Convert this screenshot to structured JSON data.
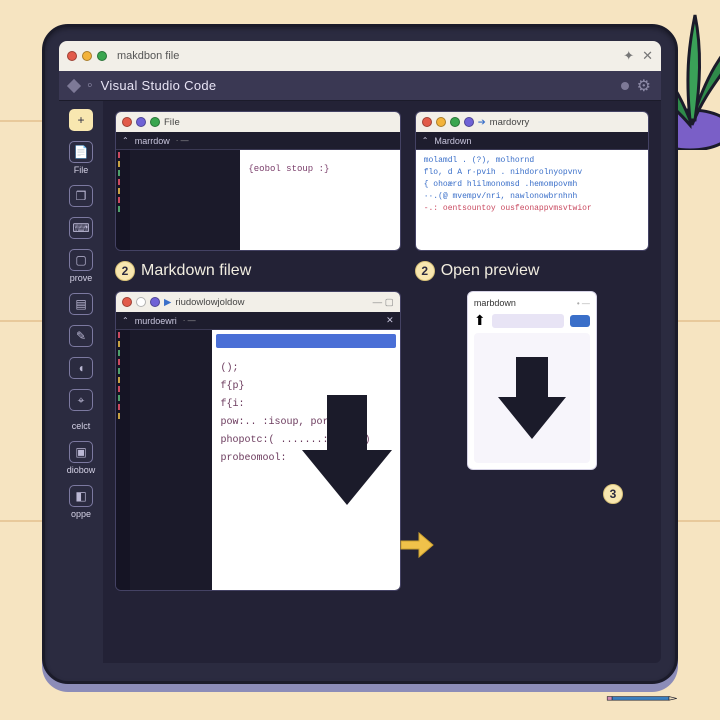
{
  "titlebar": {
    "tab_label": "makdbon file",
    "sparkle": "✦",
    "close": "✕"
  },
  "appbar": {
    "title": "Visual Studio Code"
  },
  "activity": {
    "items": [
      {
        "name": "add",
        "icon": "+",
        "label": ""
      },
      {
        "name": "file",
        "icon": "",
        "label": "File"
      },
      {
        "name": "copy",
        "icon": "❐",
        "label": ""
      },
      {
        "name": "keyboard",
        "icon": "⌨",
        "label": ""
      },
      {
        "name": "preview",
        "icon": "▢",
        "label": "prove"
      },
      {
        "name": "layers",
        "icon": "▤",
        "label": ""
      },
      {
        "name": "brush",
        "icon": "✎",
        "label": ""
      },
      {
        "name": "shape",
        "icon": "◖",
        "label": ""
      },
      {
        "name": "bug",
        "icon": "⌖",
        "label": ""
      },
      {
        "name": "select",
        "icon": "",
        "label": "celct"
      },
      {
        "name": "box",
        "icon": "▣",
        "label": "diobow"
      },
      {
        "name": "open",
        "icon": "◧",
        "label": "oppe"
      }
    ]
  },
  "panels": {
    "p1": {
      "tab_icon": "⦿",
      "tab_label": "FiIe",
      "header": "marrdow",
      "doc_text": "{eobol stoup :}"
    },
    "p2": {
      "tab_label": "mardovry",
      "header": "Mardown",
      "lines": [
        "molamdl . (?), molhornd",
        "flo, d  A r·pvih . nihdorolnyopvnv",
        " { ohoærd  hlilmonomsd .hemompovmh",
        "··.(@ mvempv/nri,  nawlonowbrnhnh",
        "-.: oentsountoy  ousfeonappvmsvtwior"
      ]
    },
    "p3": {
      "tab_label": "riudowlowjoldow",
      "header": "murdoewri",
      "code_lines": [
        "();",
        "f{p}",
        "f{i:",
        "pow:.. :isoup, porvido),",
        "",
        "phopotc:( .......:odoso:)",
        "probeomool:"
      ],
      "panel_close": "✕"
    },
    "preview": {
      "title": "marbdown",
      "up": "⬆"
    }
  },
  "steps": {
    "s2a": "Markdown filew",
    "s2b": "Open preview",
    "s3": "3"
  }
}
